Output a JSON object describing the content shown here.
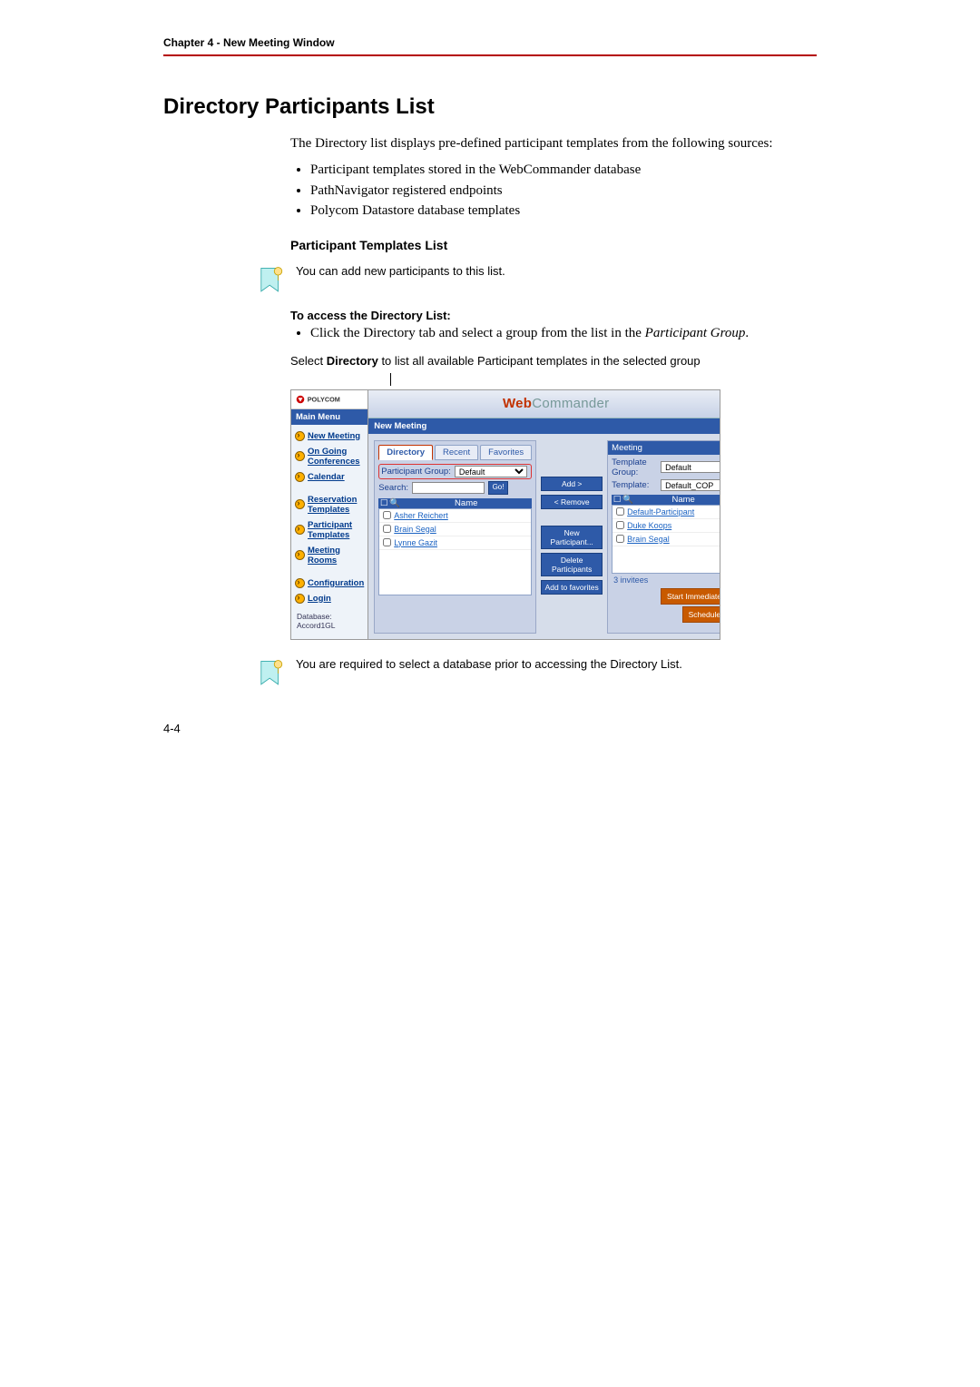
{
  "chapter": "Chapter 4 - New Meeting Window",
  "section_title": "Directory Participants List",
  "intro1": "The Directory list displays pre-defined participant templates from the following sources:",
  "bullets": {
    "b1": "Participant templates stored in the WebCommander database",
    "b2": "PathNavigator registered endpoints",
    "b3": "Polycom Datastore database templates"
  },
  "sub_heading": "Participant Templates List",
  "note1": "You can add new participants to this list.",
  "instr_head": "To access the Directory List:",
  "step_prefix": "Click the Director",
  "step_mid": "y tab and select a group from the list in the ",
  "step_italic": "Participant Group",
  "step_end": ".",
  "caption_prefix": "Select ",
  "caption_bold": "Directory",
  "caption_rest": " to list all available Participant templates in the selected group",
  "note2": "You are required to select a database prior to accessing the Directory List.",
  "page_number": "4-4",
  "shot": {
    "logo_brand": "POLYCOM",
    "banner_red": "Web",
    "banner_gray": "Commander",
    "sidebar_title": "Main Menu",
    "side_items": {
      "new_meeting": "New Meeting",
      "ongoing": "On Going Conferences",
      "calendar": "Calendar",
      "res_templates": "Reservation Templates",
      "part_templates": "Participant Templates",
      "meeting_rooms": "Meeting Rooms",
      "config": "Configuration",
      "login": "Login"
    },
    "side_db": "Database: Accord1GL",
    "sub_banner": "New Meeting",
    "left": {
      "tabs": {
        "directory": "Directory",
        "recent": "Recent",
        "favorites": "Favorites"
      },
      "part_group_label": "Participant Group:",
      "part_group_value": "Default",
      "search_label": "Search:",
      "go_label": "Go!",
      "name_header": "Name",
      "rows": {
        "r1": "Asher Reichert",
        "r2": "Brain Segal",
        "r3": "Lynne Gazit"
      }
    },
    "mid": {
      "add": "Add >",
      "remove": "< Remove",
      "newp": "New Participant...",
      "delp": "Delete Participants",
      "addfav": "Add to favorites"
    },
    "right": {
      "heading": "Meeting",
      "tg_label": "Template Group:",
      "tg_value": "Default",
      "t_label": "Template:",
      "t_value": "Default_COP",
      "name_header": "Name",
      "rows": {
        "r1": "Default-Participant",
        "r2": "Duke Koops",
        "r3": "Brain Segal"
      },
      "invitees": "3 invitees",
      "start": "Start Immediately",
      "schedule": "Schedule..."
    }
  }
}
